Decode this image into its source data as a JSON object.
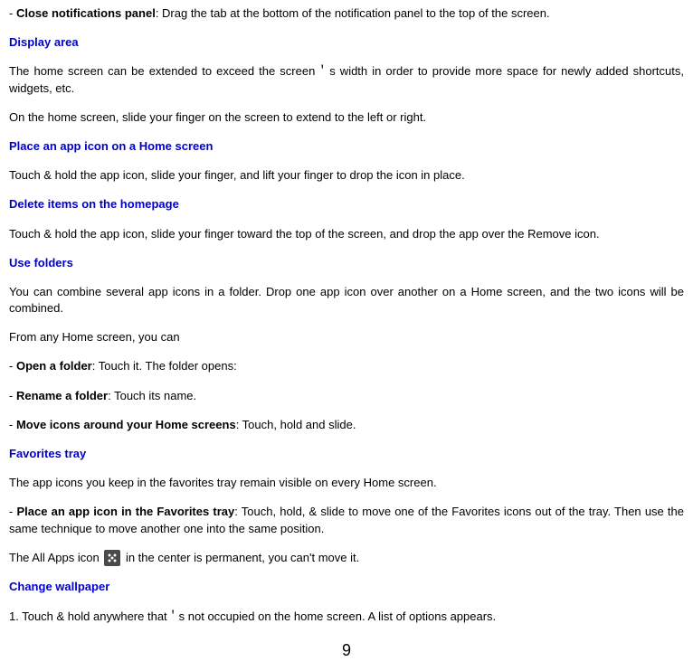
{
  "line1_prefix": "- ",
  "line1_bold": "Close notifications panel",
  "line1_rest": ": Drag the tab at the bottom of the notification panel to the top of the screen.",
  "h_display_area": "Display area",
  "p_display_area": "The home screen can be extended to exceed the screen＇s width in order to provide more space for newly added shortcuts, widgets, etc.",
  "p_display_area2": "On the home screen, slide your finger on the screen to extend to the left or right.",
  "h_place_icon": "Place an app icon on a Home screen",
  "p_place_icon": "Touch & hold the app icon, slide your finger, and lift your finger to drop the icon in place.",
  "h_delete_items": "Delete items on the homepage",
  "p_delete_items": "Touch & hold the app icon, slide your finger toward the top of the screen, and drop the app over the Remove icon.",
  "h_use_folders": "Use folders",
  "p_use_folders": "You can combine several app icons in a folder. Drop one app icon over another on a Home screen, and the two icons will be combined.",
  "p_from_any": "From any Home screen, you can",
  "li_open_prefix": "- ",
  "li_open_bold": "Open a folder",
  "li_open_rest": ": Touch it. The folder opens:",
  "li_rename_prefix": "- ",
  "li_rename_bold": "Rename a folder",
  "li_rename_rest": ": Touch its name.",
  "li_move_prefix": "- ",
  "li_move_bold": "Move icons around your Home screens",
  "li_move_rest": ": Touch, hold and slide.",
  "h_favorites": "Favorites tray",
  "p_favorites": "The app icons you keep in the favorites tray remain visible on every Home screen.",
  "li_place_fav_prefix": "- ",
  "li_place_fav_bold": "Place an app icon in the Favorites tray",
  "li_place_fav_rest": ": Touch, hold, & slide to move one of the Favorites icons out of the tray. Then use the same technique to move another one into the same position.",
  "p_allapps_before": "The All Apps icon ",
  "p_allapps_after": " in the center is permanent, you can't move it.",
  "h_change_wallpaper": "Change wallpaper",
  "p_change_wallpaper": "1. Touch & hold anywhere that＇s not occupied on the home screen. A list of options appears.",
  "page_number": "9"
}
